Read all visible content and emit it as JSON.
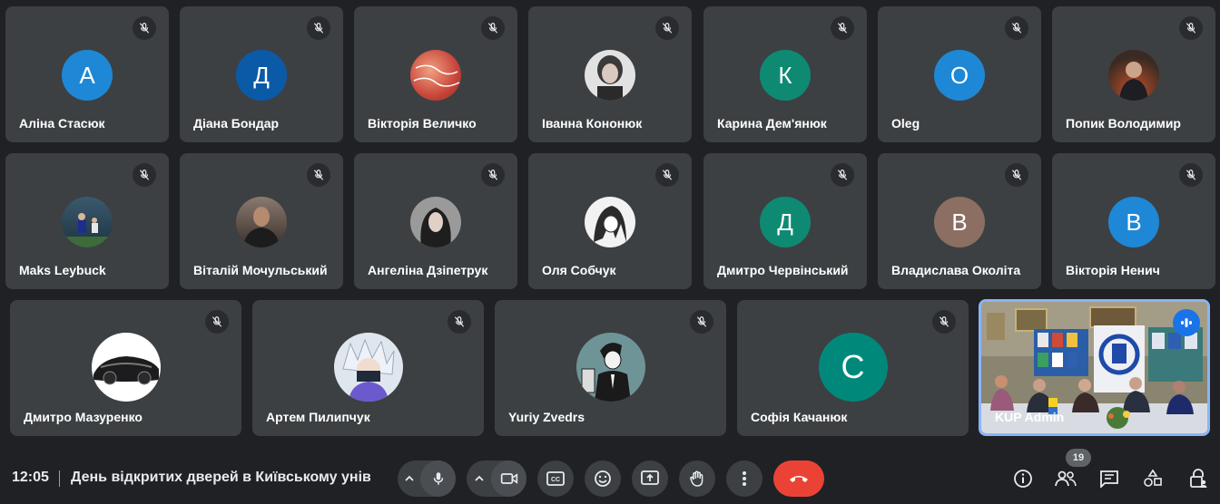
{
  "participants_row1": [
    {
      "name": "Аліна Стасюк",
      "initial": "А",
      "color": "#1e88d6"
    },
    {
      "name": "Діана Бондар",
      "initial": "Д",
      "color": "#0b5aa8"
    },
    {
      "name": "Вікторія Величко",
      "initial": "",
      "color": "#c8463a"
    },
    {
      "name": "Іванна Кононюк",
      "initial": "",
      "color": "#d6d6d6"
    },
    {
      "name": "Карина Дем'янюк",
      "initial": "К",
      "color": "#0e8a73"
    },
    {
      "name": "Oleg",
      "initial": "O",
      "color": "#1e88d6"
    },
    {
      "name": "Попик Володимир",
      "initial": "",
      "color": "#3a2a22"
    }
  ],
  "participants_row2": [
    {
      "name": "Maks Leybuck",
      "initial": "",
      "color": "#2d4a5c"
    },
    {
      "name": "Віталій Мочульський",
      "initial": "",
      "color": "#5a4a42"
    },
    {
      "name": "Ангеліна Дзіпетрук",
      "initial": "",
      "color": "#777777"
    },
    {
      "name": "Оля Собчук",
      "initial": "",
      "color": "#e6e6e6"
    },
    {
      "name": "Дмитро Червінський",
      "initial": "Д",
      "color": "#0e8a73"
    },
    {
      "name": "Владислава Околіта",
      "initial": "В",
      "color": "#8d6e63"
    },
    {
      "name": "Вікторія Ненич",
      "initial": "В",
      "color": "#1e88d6"
    }
  ],
  "participants_row3": [
    {
      "name": "Дмитро Мазуренко",
      "initial": "",
      "color": "#ffffff"
    },
    {
      "name": "Артем Пилипчук",
      "initial": "",
      "color": "#c9d6e8"
    },
    {
      "name": "Yuriy Zvedrs",
      "initial": "",
      "color": "#6a8a8c"
    },
    {
      "name": "Софія Качанюк",
      "initial": "C",
      "color": "#00897b"
    }
  ],
  "featured": {
    "name": "KUP Admin"
  },
  "toolbar": {
    "time": "12:05",
    "meeting_title": "День відкритих дверей в Київському університеті",
    "participant_count": "19"
  }
}
